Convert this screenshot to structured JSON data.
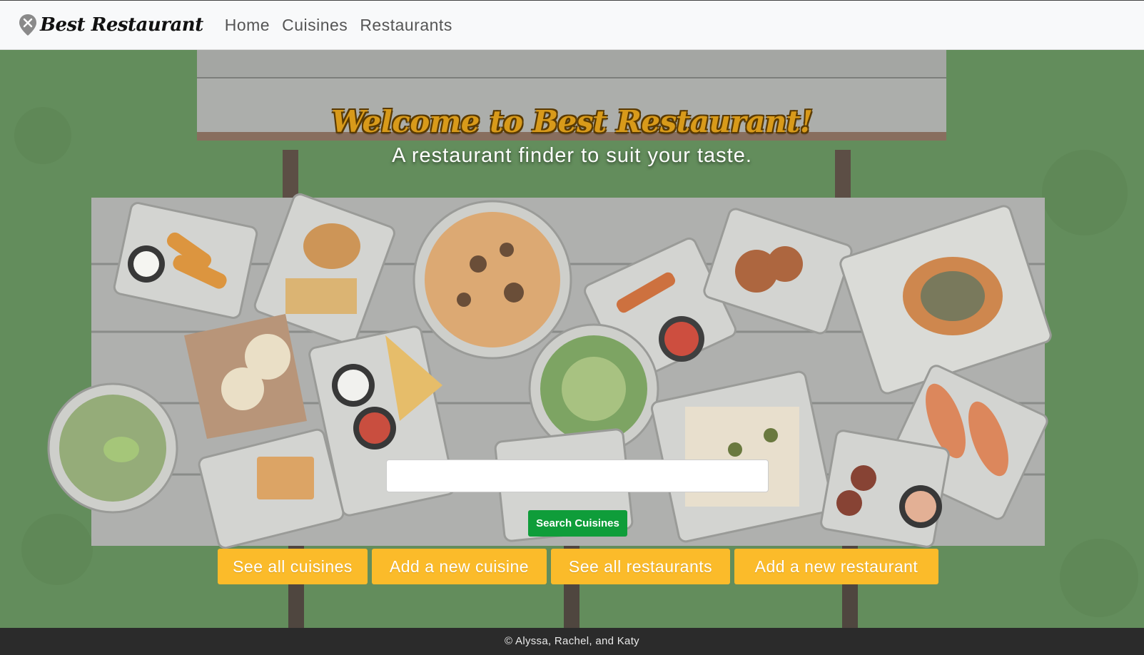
{
  "navbar": {
    "brand_name": "Best Restaurant",
    "brand_icon": "map-pin-utensils-icon",
    "links": [
      {
        "label": "Home"
      },
      {
        "label": "Cuisines"
      },
      {
        "label": "Restaurants"
      }
    ]
  },
  "hero": {
    "title": "Welcome to Best Restaurant!",
    "subtitle": "A restaurant finder to suit your taste.",
    "search": {
      "value": "",
      "placeholder": "",
      "button_label": "Search Cuisines"
    },
    "actions": [
      {
        "label": "See all cuisines"
      },
      {
        "label": "Add a new cuisine"
      },
      {
        "label": "See all restaurants"
      },
      {
        "label": "Add a new restaurant"
      }
    ]
  },
  "footer": {
    "text": "© Alyssa, Rachel, and Katy"
  },
  "colors": {
    "navbar_bg": "#f8f9fa",
    "title": "#d89a1a",
    "search_button": "#0f9d3a",
    "action_button": "#fbbb2a",
    "footer_bg": "#2b2b2b"
  }
}
